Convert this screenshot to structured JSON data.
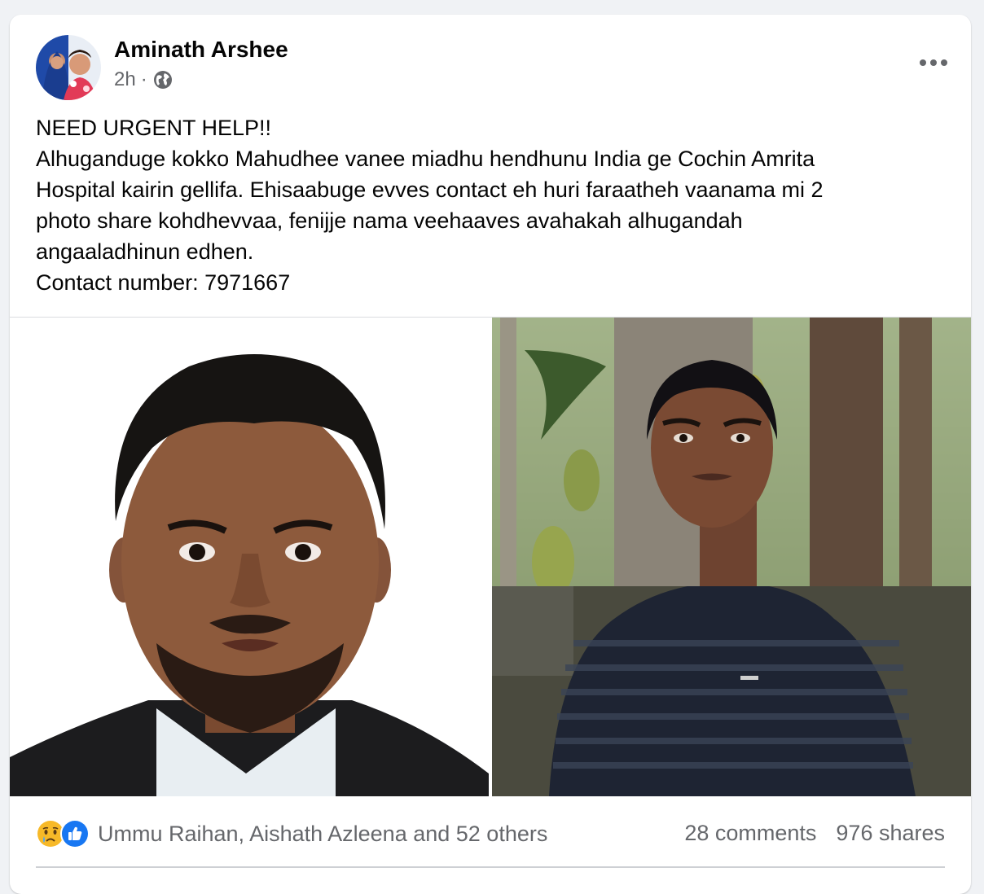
{
  "post": {
    "author": "Aminath Arshee",
    "time": "2h",
    "separator": "·",
    "privacy_icon": "globe-icon",
    "more_icon": "more-dots-icon",
    "text_lines": [
      "NEED URGENT HELP!!",
      "Alhuganduge kokko Mahudhee vanee miadhu hendhunu India ge Cochin Amrita",
      "Hospital kairin gellifa. Ehisaabuge evves contact eh huri faraatheh vaanama mi 2",
      "photo share kohdhevvaa, fenijje nama veehaaves avahakah alhugandah",
      "angaaladhinun edhen.",
      "Contact number: 7971667"
    ]
  },
  "photos": [
    {
      "icon": "portrait-photo"
    },
    {
      "icon": "outdoor-photo"
    }
  ],
  "footer": {
    "reaction_icons": [
      "sad-reaction-icon",
      "like-reaction-icon"
    ],
    "reactors": "Ummu Raihan, Aishath Azleena and 52 others",
    "comments": "28 comments",
    "shares": "976 shares"
  },
  "colors": {
    "like_blue": "#1877f2",
    "sad_yellow": "#f7b928",
    "secondary_text": "#65676b"
  }
}
